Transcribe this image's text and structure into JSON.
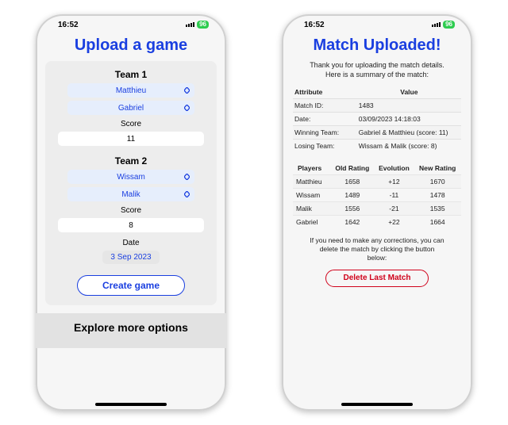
{
  "status": {
    "time": "16:52",
    "battery": "96"
  },
  "left": {
    "title": "Upload a game",
    "team1": {
      "label": "Team 1",
      "player1": "Matthieu",
      "player2": "Gabriel",
      "score_label": "Score",
      "score": "11"
    },
    "team2": {
      "label": "Team 2",
      "player1": "Wissam",
      "player2": "Malik",
      "score_label": "Score",
      "score": "8"
    },
    "date_label": "Date",
    "date_value": "3 Sep 2023",
    "create_btn": "Create game",
    "explore": "Explore more options"
  },
  "right": {
    "title": "Match Uploaded!",
    "thanks1": "Thank you for uploading the match details.",
    "thanks2": "Here is a summary of the match:",
    "summary": {
      "headers": {
        "attr": "Attribute",
        "val": "Value"
      },
      "rows": [
        {
          "attr": "Match ID:",
          "val": "1483"
        },
        {
          "attr": "Date:",
          "val": "03/09/2023 14:18:03"
        },
        {
          "attr": "Winning Team:",
          "val": "Gabriel & Matthieu (score: 11)"
        },
        {
          "attr": "Losing Team:",
          "val": "Wissam & Malik (score: 8)"
        }
      ]
    },
    "ratings": {
      "headers": {
        "p": "Players",
        "old": "Old Rating",
        "evo": "Evolution",
        "new": "New Rating"
      },
      "rows": [
        {
          "p": "Matthieu",
          "old": "1658",
          "evo": "+12",
          "new": "1670"
        },
        {
          "p": "Wissam",
          "old": "1489",
          "evo": "-11",
          "new": "1478"
        },
        {
          "p": "Malik",
          "old": "1556",
          "evo": "-21",
          "new": "1535"
        },
        {
          "p": "Gabriel",
          "old": "1642",
          "evo": "+22",
          "new": "1664"
        }
      ]
    },
    "note1": "If you need to make any corrections, you can",
    "note2": "delete the match by clicking the button",
    "note3": "below:",
    "delete_btn": "Delete Last Match"
  }
}
